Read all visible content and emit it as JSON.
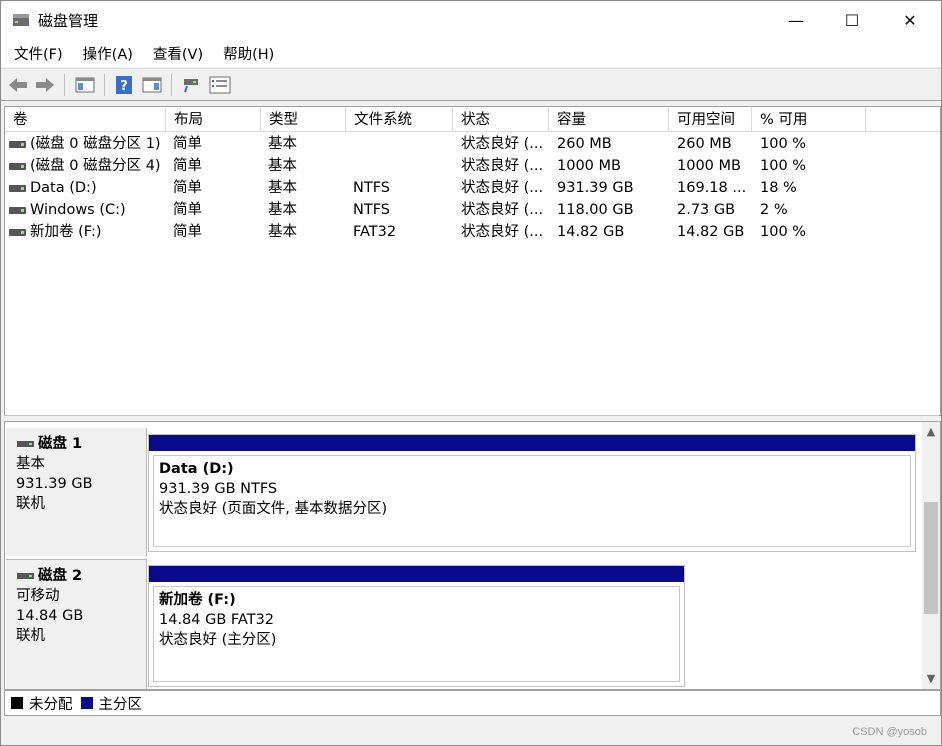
{
  "window": {
    "title": "磁盘管理",
    "minimize": "—",
    "maximize": "☐",
    "close": "✕"
  },
  "menu": [
    "文件(F)",
    "操作(A)",
    "查看(V)",
    "帮助(H)"
  ],
  "toolbar": {
    "icons": [
      "back-arrow-icon",
      "forward-arrow-icon",
      "console-tree-icon",
      "help-icon",
      "properties-pane-icon",
      "connect-icon",
      "list-view-icon"
    ]
  },
  "volume_table": {
    "columns": [
      "卷",
      "布局",
      "类型",
      "文件系统",
      "状态",
      "容量",
      "可用空间",
      "% 可用"
    ],
    "rows": [
      [
        "(磁盘 0 磁盘分区 1)",
        "简单",
        "基本",
        "",
        "状态良好 (...",
        "260 MB",
        "260 MB",
        "100 %"
      ],
      [
        "(磁盘 0 磁盘分区 4)",
        "简单",
        "基本",
        "",
        "状态良好 (...",
        "1000 MB",
        "1000 MB",
        "100 %"
      ],
      [
        "Data (D:)",
        "简单",
        "基本",
        "NTFS",
        "状态良好 (...",
        "931.39 GB",
        "169.18 ...",
        "18 %"
      ],
      [
        "Windows (C:)",
        "简单",
        "基本",
        "NTFS",
        "状态良好 (...",
        "118.00 GB",
        "2.73 GB",
        "2 %"
      ],
      [
        "新加卷 (F:)",
        "简单",
        "基本",
        "FAT32",
        "状态良好 (...",
        "14.82 GB",
        "14.82 GB",
        "100 %"
      ]
    ]
  },
  "disks": [
    {
      "name": "磁盘 1",
      "type": "基本",
      "size": "931.39 GB",
      "status": "联机",
      "partition": {
        "name": "Data  (D:)",
        "size_fs": "931.39 GB NTFS",
        "status": "状态良好 (页面文件, 基本数据分区)"
      }
    },
    {
      "name": "磁盘 2",
      "type": "可移动",
      "size": "14.84 GB",
      "status": "联机",
      "partition": {
        "name": "新加卷  (F:)",
        "size_fs": "14.84 GB FAT32",
        "status": "状态良好 (主分区)"
      }
    }
  ],
  "legend": [
    {
      "label": "未分配",
      "color": "#000000"
    },
    {
      "label": "主分区",
      "color": "#0a0a8c"
    }
  ],
  "watermark": "CSDN @yosob"
}
